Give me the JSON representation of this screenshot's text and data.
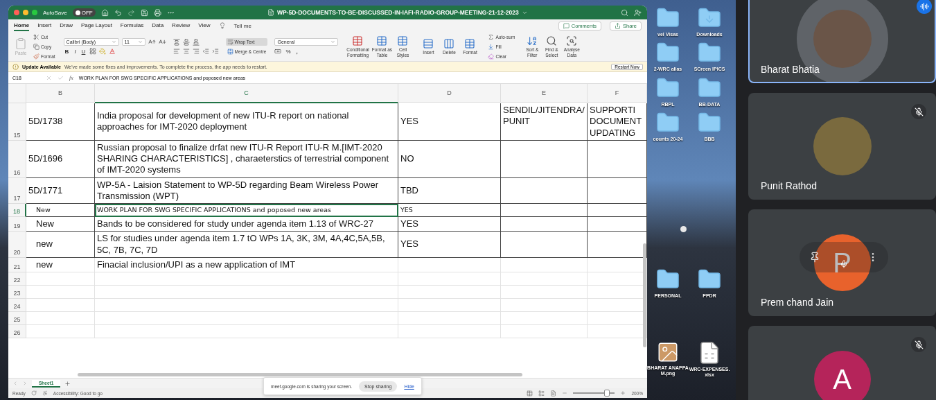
{
  "excel": {
    "title": "WP-5D-DOCUMENTS-TO-BE-DISCUSSED-IN-IAFI-RADIO-GROUP-MEETING-21-12-2023",
    "autosave": {
      "label": "AutoSave",
      "state": "OFF",
      "on": false
    },
    "tabs": [
      {
        "label": "Home",
        "selected": true
      },
      {
        "label": "Insert",
        "selected": false
      },
      {
        "label": "Draw",
        "selected": false
      },
      {
        "label": "Page Layout",
        "selected": false
      },
      {
        "label": "Formulas",
        "selected": false
      },
      {
        "label": "Data",
        "selected": false
      },
      {
        "label": "Review",
        "selected": false
      },
      {
        "label": "View",
        "selected": false
      }
    ],
    "tell_me": "Tell me",
    "comments": "Comments",
    "share": "Share",
    "ribbon": {
      "paste": {
        "label": "Paste",
        "disabled": true
      },
      "cut": "Cut",
      "copy": "Copy",
      "format_painter": "Format",
      "font": "Calibri (Body)",
      "font_size": "11",
      "bold": "B",
      "italic": "I",
      "underline": "U",
      "wrap_text": {
        "label": "Wrap Text",
        "on": true
      },
      "merge": "Merge & Centre",
      "number_format": "General",
      "percent": "%",
      "comma": ",",
      "conditional": "Conditional Formatting",
      "format_table": "Format as Table",
      "cell_styles": "Cell Styles",
      "insert": "Insert",
      "delete": "Delete",
      "format": "Format",
      "autosum": "Auto-sum",
      "fill": "Fill",
      "clear": "Clear",
      "sort": "Sort & Filter",
      "find": "Find & Select",
      "analyse": "Analyse Data"
    },
    "update": {
      "title": "Update Available",
      "message": "We've made some fixes and improvements. To complete the process, the app needs to restart.",
      "button": "Restart Now"
    },
    "formula_bar": {
      "cell": "C18",
      "fx": "fx",
      "formula": "WORK PLAN FOR SWG SPECIFIC APPLICATIONS  and poposed new areas"
    },
    "columns": [
      {
        "label": "B",
        "selected": false
      },
      {
        "label": "C",
        "selected": true
      },
      {
        "label": "D",
        "selected": false
      },
      {
        "label": "E",
        "selected": false
      },
      {
        "label": "F",
        "selected": false
      }
    ],
    "rows": [
      {
        "number": "15",
        "selected": false,
        "bordered": true,
        "kind": "normal",
        "cells": [
          "5D/1738",
          "India proposal for development of new ITU-R report on national approaches for IMT-2020 deployment",
          "YES",
          "SENDIL/JITENDRA/PUNIT",
          "SUPPORTI\nDOCUMENT\nUPDATING"
        ]
      },
      {
        "number": "16",
        "selected": false,
        "bordered": true,
        "kind": "normal",
        "cells": [
          "5D/1696",
          "Russian proposal to finalize drfat new ITU-R Report ITU-R M.[IMT-2020 SHARING CHARACTERISTICS] , charaeterstics of terrestrial component of IMT-2020 systems",
          "NO"
        ]
      },
      {
        "number": "17",
        "selected": false,
        "bordered": true,
        "kind": "normal",
        "cells": [
          "5D/1771",
          "WP-5A - Laision Statement to WP-5D regarding Beam Wireless Power Transmission (WPT)",
          "TBD"
        ]
      },
      {
        "number": "18",
        "selected": true,
        "bordered": true,
        "kind": "compact",
        "cells": [
          "New",
          "WORK PLAN FOR SWG SPECIFIC APPLICATIONS  and poposed new areas",
          "YES"
        ]
      },
      {
        "number": "19",
        "selected": false,
        "bordered": true,
        "kind": "normal",
        "cells": [
          "New",
          "Bands to be considered for study under agenda item 1.13 of WRC-27",
          "YES"
        ]
      },
      {
        "number": "20",
        "selected": false,
        "bordered": true,
        "kind": "normal",
        "cells": [
          "new",
          "LS for studies under agenda item 1.7  tO WPs 1A, 3K, 3M, 4A,4C,5A,5B, 5C, 7B, 7C, 7D",
          "YES"
        ]
      },
      {
        "number": "21",
        "selected": false,
        "bordered": false,
        "kind": "normal",
        "cells": [
          "new",
          "Finacial inclusion/UPI as a new application of IMT"
        ]
      },
      {
        "number": "22",
        "selected": false,
        "bordered": false,
        "kind": "normal",
        "cells": []
      },
      {
        "number": "23",
        "selected": false,
        "bordered": false,
        "kind": "normal",
        "cells": []
      },
      {
        "number": "24",
        "selected": false,
        "bordered": false,
        "kind": "normal",
        "cells": []
      },
      {
        "number": "25",
        "selected": false,
        "bordered": false,
        "kind": "normal",
        "cells": []
      },
      {
        "number": "26",
        "selected": false,
        "bordered": false,
        "kind": "normal",
        "cells": []
      }
    ],
    "sheets": [
      {
        "label": "Sheet1",
        "selected": true
      }
    ],
    "status": {
      "ready": "Ready",
      "accessibility": "Accessibility: Good to go",
      "zoom": "200%",
      "level": 0.8
    },
    "share_notice": {
      "message": "meet.google.com is sharing your screen.",
      "stop": "Stop sharing",
      "hide": "Hide"
    }
  },
  "desktop": {
    "groups": [
      [
        {
          "label": "vel Visas",
          "kind": "folder"
        },
        {
          "label": "Downloads",
          "kind": "downloads"
        },
        {
          "label": "2-WRC alias",
          "kind": "folder"
        },
        {
          "label": "SCreen IPICS",
          "kind": "folder"
        },
        {
          "label": "RBPL",
          "kind": "folder"
        },
        {
          "label": "BB-DATA",
          "kind": "folder"
        },
        {
          "label": "counts 20-24",
          "kind": "folder"
        },
        {
          "label": "BBB",
          "kind": "home"
        }
      ],
      [
        {
          "label": "PERSONAL",
          "kind": "folder"
        },
        {
          "label": "PPDR",
          "kind": "folder"
        }
      ],
      [
        {
          "label": "BHARAT ANAPPAM.png",
          "kind": "image"
        },
        {
          "label": "WRC-EXPENSES.xlsx",
          "kind": "sheet"
        }
      ]
    ]
  },
  "meet": {
    "tiles": [
      {
        "name": "Bharat Bhatia",
        "kind": "photo",
        "speaking": true,
        "muted": false,
        "controls": false
      },
      {
        "name": "Punit Rathod",
        "kind": "photo",
        "speaking": false,
        "muted": true,
        "controls": false
      },
      {
        "name": "Prem chand Jain",
        "kind": "letter",
        "letter": "P",
        "color": "#e8622c",
        "speaking": false,
        "muted": false,
        "controls": true
      },
      {
        "kind": "letter",
        "letter": "A",
        "color": "#b5245a",
        "speaking": false,
        "muted": true,
        "controls": false
      }
    ]
  }
}
